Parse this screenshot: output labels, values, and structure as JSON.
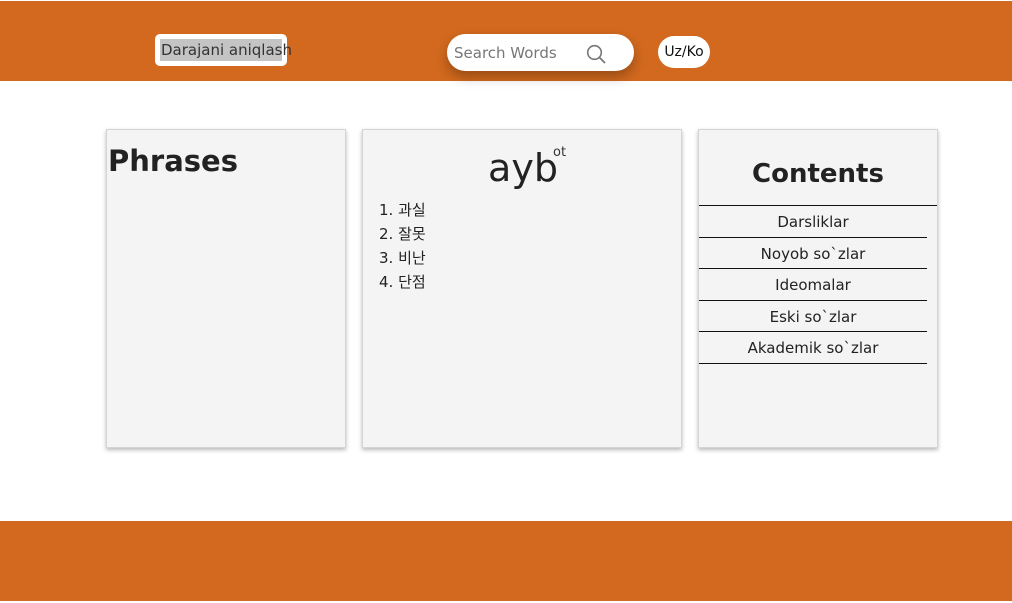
{
  "header": {
    "level_button_label": "Darajani aniqlash",
    "search_placeholder": "Search Words",
    "language_button_label": "Uz/Ko"
  },
  "phrases": {
    "title": "Phrases"
  },
  "word": {
    "headword": "ayb",
    "part_of_speech": "ot",
    "meanings": [
      "1. 과실",
      "2. 잘못",
      "3. 비난",
      "4. 단점"
    ]
  },
  "contents": {
    "title": "Contents",
    "items": [
      "Darsliklar",
      "Noyob so`zlar",
      "Ideomalar",
      "Eski so`zlar",
      "Akademik so`zlar"
    ]
  },
  "colors": {
    "brand": "#d2691e",
    "card_background": "#f4f4f4"
  },
  "icons": {
    "search": "search-icon"
  }
}
